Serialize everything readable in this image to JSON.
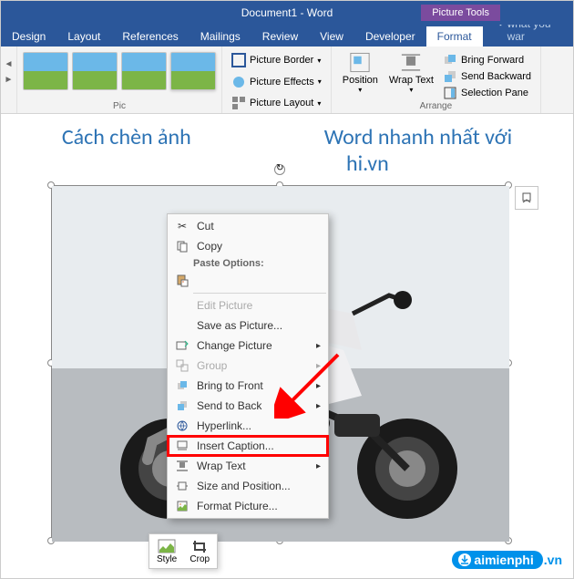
{
  "titlebar": {
    "doc_title": "Document1 - Word",
    "picture_tools": "Picture Tools"
  },
  "tabs": {
    "items": [
      "Design",
      "Layout",
      "References",
      "Mailings",
      "Review",
      "View",
      "Developer",
      "Format"
    ],
    "active_index": 7,
    "tell_me": "Tell me what you war"
  },
  "ribbon": {
    "group_picture_styles": "Pic",
    "picture_border": "Picture Border",
    "picture_effects": "Picture Effects",
    "picture_layout": "Picture Layout",
    "position": "Position",
    "wrap_text": "Wrap Text",
    "bring_forward": "Bring Forward",
    "send_backward": "Send Backward",
    "selection_pane": "Selection Pane",
    "arrange": "Arrange"
  },
  "document": {
    "heading_line1": "Cách chèn ảnh",
    "heading_mid": "Word nhanh nhất với",
    "heading_line2": "hi.vn"
  },
  "context_menu": {
    "cut": "Cut",
    "copy": "Copy",
    "paste_options": "Paste Options:",
    "edit_picture": "Edit Picture",
    "save_as_picture": "Save as Picture...",
    "change_picture": "Change Picture",
    "group": "Group",
    "bring_to_front": "Bring to Front",
    "send_to_back": "Send to Back",
    "hyperlink": "Hyperlink...",
    "insert_caption": "Insert Caption...",
    "wrap_text": "Wrap Text",
    "size_and_position": "Size and Position...",
    "format_picture": "Format Picture..."
  },
  "mini_toolbar": {
    "style": "Style",
    "crop": "Crop"
  },
  "watermark": {
    "text": "aimienphi",
    "ext": ".vn"
  }
}
